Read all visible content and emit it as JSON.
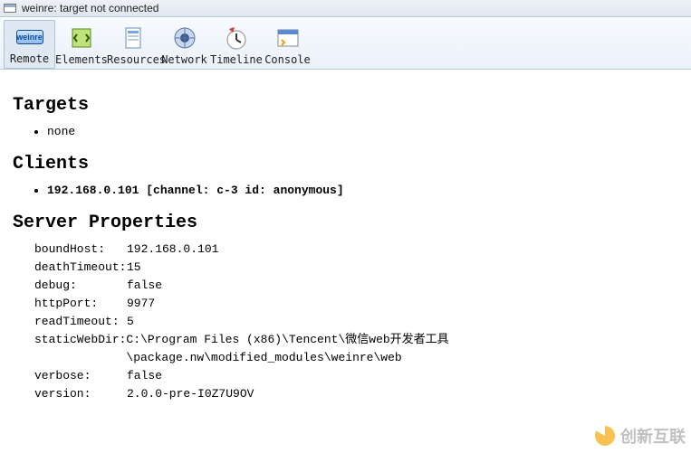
{
  "window": {
    "title": "weinre: target not connected"
  },
  "toolbar": {
    "items": [
      {
        "label": "Remote",
        "name": "tab-remote",
        "active": true
      },
      {
        "label": "Elements",
        "name": "tab-elements",
        "active": false
      },
      {
        "label": "Resources",
        "name": "tab-resources",
        "active": false
      },
      {
        "label": "Network",
        "name": "tab-network",
        "active": false
      },
      {
        "label": "Timeline",
        "name": "tab-timeline",
        "active": false
      },
      {
        "label": "Console",
        "name": "tab-console",
        "active": false
      }
    ]
  },
  "sections": {
    "targets": {
      "heading": "Targets",
      "items": [
        {
          "text": "none",
          "bold": false
        }
      ]
    },
    "clients": {
      "heading": "Clients",
      "items": [
        {
          "text": "192.168.0.101 [channel: c-3 id: anonymous]",
          "bold": true
        }
      ]
    },
    "serverProps": {
      "heading": "Server Properties",
      "rows": [
        {
          "key": "boundHost:",
          "val": "192.168.0.101"
        },
        {
          "key": "deathTimeout:",
          "val": "15"
        },
        {
          "key": "debug:",
          "val": "false"
        },
        {
          "key": "httpPort:",
          "val": "9977"
        },
        {
          "key": "readTimeout:",
          "val": "5"
        },
        {
          "key": "staticWebDir:",
          "val": "C:\\Program Files (x86)\\Tencent\\微信web开发者工具\\package.nw\\modified_modules\\weinre\\web"
        },
        {
          "key": "verbose:",
          "val": "false"
        },
        {
          "key": "version:",
          "val": "2.0.0-pre-I0Z7U9OV"
        }
      ]
    }
  },
  "watermark": "创新互联"
}
